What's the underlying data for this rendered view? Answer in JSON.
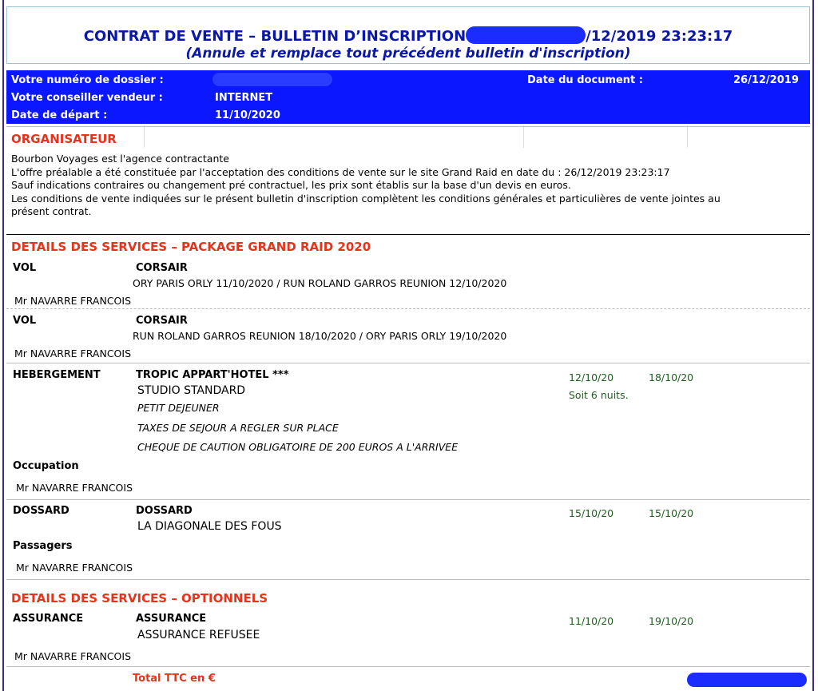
{
  "header": {
    "title_prefix": "CONTRAT DE VENTE – BULLETIN D’INSCRIPTION",
    "title_suffix": "/12/2019 23:23:17",
    "subtitle": "(Annule et remplace tout précédent bulletin d'inscription)"
  },
  "info": {
    "dossier_label": "Votre numéro de dossier :",
    "doc_date_label": "Date du document :",
    "doc_date": "26/12/2019",
    "conseiller_label": "Votre conseiller vendeur :",
    "conseiller": "INTERNET",
    "depart_label": "Date de départ :",
    "depart": "11/10/2020"
  },
  "organisateur": {
    "heading": "ORGANISATEUR",
    "lines": [
      "Bourbon Voyages est l'agence contractante",
      "L'offre préalable a été constituée par l'acceptation des conditions de vente sur le site Grand Raid en date du : 26/12/2019 23:23:17",
      "Sauf indications contraires ou changement pré contractuel, les prix sont établis sur la base d'un devis en euros.",
      "Les conditions de vente indiquées sur le présent bulletin d'inscription complètent les conditions générales et particulières de vente jointes au",
      "présent contrat."
    ]
  },
  "package": {
    "heading": "DETAILS DES SERVICES – PACKAGE GRAND RAID 2020",
    "vol1": {
      "type": "VOL",
      "carrier": "CORSAIR",
      "route": "ORY PARIS ORLY 11/10/2020  / RUN ROLAND GARROS REUNION 12/10/2020",
      "passenger": "Mr  NAVARRE  FRANCOIS"
    },
    "vol2": {
      "type": "VOL",
      "carrier": "CORSAIR",
      "route": "RUN ROLAND GARROS REUNION 18/10/2020  / ORY PARIS ORLY 19/10/2020",
      "passenger": "Mr  NAVARRE  FRANCOIS"
    },
    "hotel": {
      "type": "HEBERGEMENT",
      "name": "TROPIC APPART'HOTEL ***",
      "room": "STUDIO STANDARD",
      "board": "PETIT DEJEUNER",
      "note1": "TAXES DE SEJOUR A REGLER SUR PLACE",
      "note2": "CHEQUE DE CAUTION OBLIGATOIRE DE 200 EUROS A L'ARRIVEE",
      "start": "12/10/20",
      "end": "18/10/20",
      "nights": "Soit 6 nuits.",
      "occupation_label": "Occupation",
      "passenger": "Mr  NAVARRE  FRANCOIS"
    },
    "dossard": {
      "type": "DOSSARD",
      "name": "DOSSARD",
      "race": "LA DIAGONALE DES FOUS",
      "start": "15/10/20",
      "end": "15/10/20",
      "passagers_label": "Passagers",
      "passenger": "Mr  NAVARRE  FRANCOIS"
    }
  },
  "options": {
    "heading": "DETAILS DES SERVICES – OPTIONNELS",
    "assurance": {
      "type": "ASSURANCE",
      "name": "ASSURANCE",
      "status": "ASSURANCE REFUSEE",
      "start": "11/10/20",
      "end": "19/10/20",
      "passenger": "Mr  NAVARRE  FRANCOIS"
    }
  },
  "total_label": "Total TTC en €",
  "colors": {
    "title": "#0a17a8",
    "bar": "#0a17ff",
    "section": "#e8321c",
    "dates": "#1e5e1e"
  }
}
